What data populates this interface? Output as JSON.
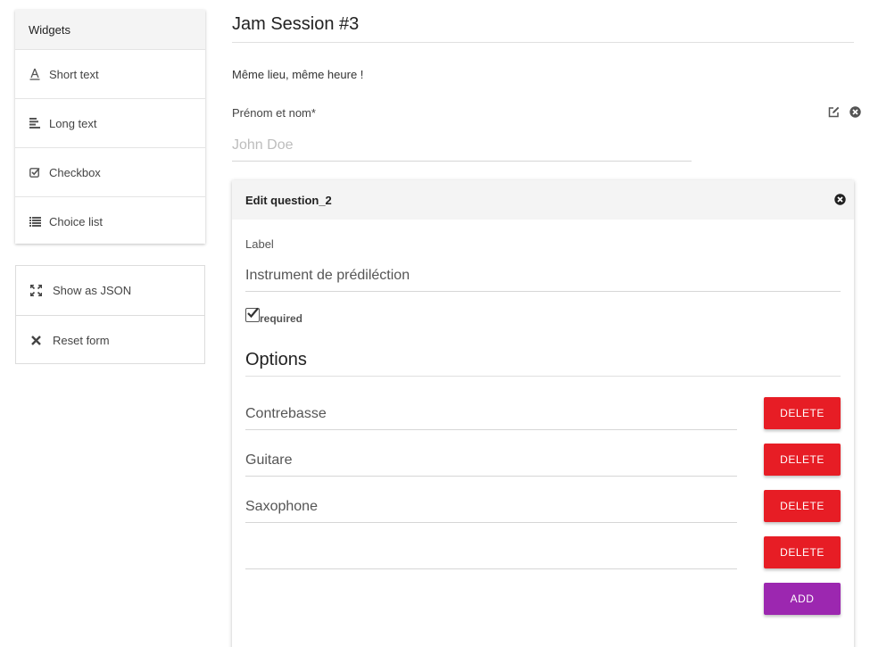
{
  "sidebar": {
    "header": "Widgets",
    "items": [
      {
        "label": "Short text",
        "icon": "text-format-icon"
      },
      {
        "label": "Long text",
        "icon": "align-left-icon"
      },
      {
        "label": "Checkbox",
        "icon": "checkbox-icon"
      },
      {
        "label": "Choice list",
        "icon": "list-icon"
      }
    ],
    "actions": [
      {
        "label": "Show as JSON",
        "icon": "expand-icon"
      },
      {
        "label": "Reset form",
        "icon": "close-icon"
      }
    ]
  },
  "form": {
    "title": "Jam Session #3",
    "description": "Même lieu, même heure !",
    "question": {
      "label": "Prénom et nom*",
      "placeholder": "John Doe"
    }
  },
  "editor": {
    "title": "Edit question_2",
    "label_caption": "Label",
    "label_value": "Instrument de prédiléction",
    "required_label": "required",
    "required_checked": true,
    "options_title": "Options",
    "options": [
      "Contrebasse",
      "Guitare",
      "Saxophone",
      ""
    ],
    "delete_label": "DELETE",
    "add_label": "ADD"
  },
  "colors": {
    "delete": "#e71d25",
    "add": "#9c27b0",
    "header_bg": "#f4f4f4"
  }
}
